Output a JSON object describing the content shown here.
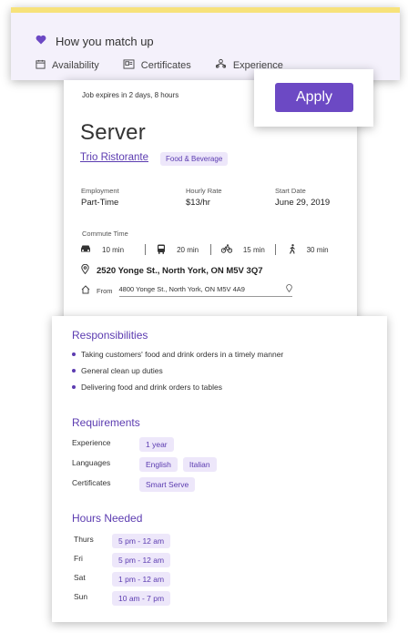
{
  "match": {
    "title": "How you match up",
    "filters": [
      {
        "label": "Availability",
        "icon": "calendar-icon"
      },
      {
        "label": "Certificates",
        "icon": "certificate-icon"
      },
      {
        "label": "Experience",
        "icon": "experience-icon"
      }
    ]
  },
  "apply": {
    "label": "Apply"
  },
  "job": {
    "expires": "Job expires in 2 days, 8 hours",
    "title": "Server",
    "company": "Trio Ristorante",
    "category": "Food & Beverage",
    "info": [
      {
        "label": "Employment",
        "value": "Part-Time"
      },
      {
        "label": "Hourly Rate",
        "value": "$13/hr"
      },
      {
        "label": "Start Date",
        "value": "June 29, 2019"
      }
    ],
    "commute": {
      "label": "Commute Time",
      "modes": [
        {
          "icon": "car-icon",
          "time": "10 min"
        },
        {
          "icon": "bus-icon",
          "time": "20 min"
        },
        {
          "icon": "bike-icon",
          "time": "15 min"
        },
        {
          "icon": "walk-icon",
          "time": "30 min"
        }
      ]
    },
    "address": "2520 Yonge St., North York, ON M5V 3Q7",
    "from_label": "From",
    "from_value": "4800 Yonge St., North York, ON M5V 4A9"
  },
  "details": {
    "responsibilities_title": "Responsibilities",
    "responsibilities": [
      "Taking customers' food and drink orders in a timely manner",
      "General clean up duties",
      "Delivering food and drink orders to tables"
    ],
    "requirements_title": "Requirements",
    "requirements": [
      {
        "label": "Experience",
        "chips": [
          "1 year"
        ]
      },
      {
        "label": "Languages",
        "chips": [
          "English",
          "Italian"
        ]
      },
      {
        "label": "Certificates",
        "chips": [
          "Smart Serve"
        ]
      }
    ],
    "hours_title": "Hours Needed",
    "hours": [
      {
        "day": "Thurs",
        "time": "5 pm - 12 am"
      },
      {
        "day": "Fri",
        "time": "5 pm - 12 am"
      },
      {
        "day": "Sat",
        "time": "1 pm - 12 am"
      },
      {
        "day": "Sun",
        "time": "10 am - 7 pm"
      }
    ]
  },
  "colors": {
    "accent": "#6c49c4",
    "highlight": "#f7e27a",
    "chip_bg": "#ede7fa"
  }
}
